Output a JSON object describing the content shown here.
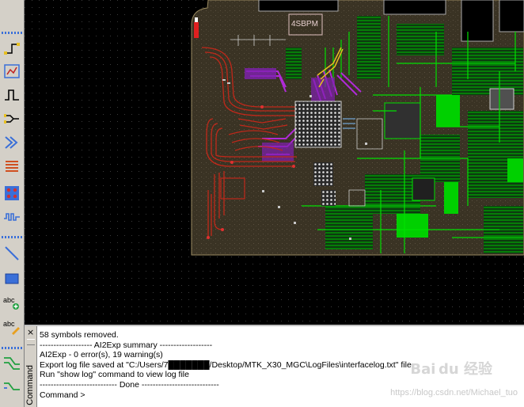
{
  "toolbar": {
    "icons": [
      "connect-pin-icon",
      "route-net-icon",
      "trace-bend-icon",
      "diff-pair-icon",
      "bus-route-icon",
      "fanout-icon",
      "via-array-icon",
      "tuning-icon",
      "draw-line-icon",
      "draw-rect-icon",
      "add-text-icon",
      "edit-text-icon",
      "route-icon-a",
      "route-icon-b"
    ]
  },
  "canvas": {
    "background": "#000000",
    "grid_color": "#3c3c3c",
    "board_color": "#3a3324",
    "trace_colors": [
      "#00e000",
      "#c0281a",
      "#b02ad8",
      "#e8c020",
      "#ffffff",
      "#80c0ff"
    ],
    "silkscreen_label": "4SBPM"
  },
  "command_panel": {
    "close_glyph": "×",
    "side_title": "Command",
    "lines": [
      "58 symbols removed.",
      "------------------- AI2Exp summary -------------------",
      "AI2Exp - 0 error(s), 19 warning(s)",
      "Export log file saved at \"C:/Users/7███████/Desktop/MTK_X30_MGC\\LogFiles\\interfacelog.txt\" file",
      "Run \"show log\" command to view log file",
      "---------------------------- Done ----------------------------",
      "Command >"
    ]
  },
  "watermark": {
    "brand": "Bai du 经验",
    "url": "https://blog.csdn.net/Michael_tuo"
  }
}
